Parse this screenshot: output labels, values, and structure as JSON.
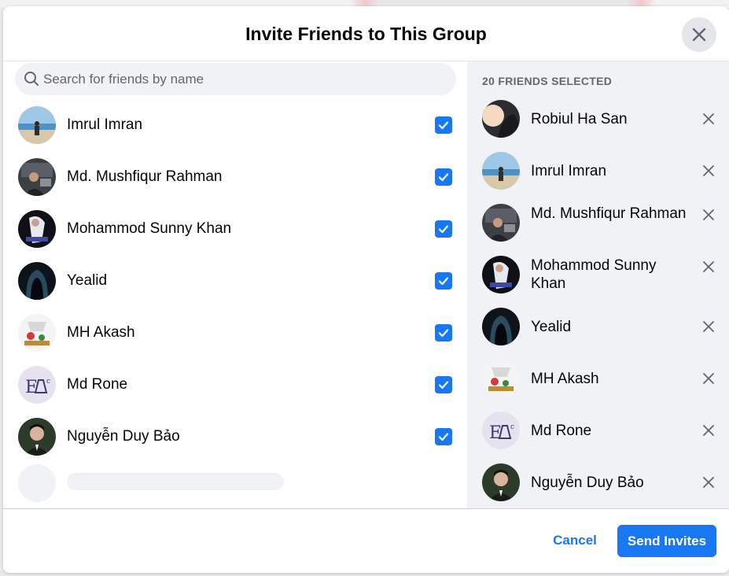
{
  "dialog": {
    "title": "Invite Friends to This Group",
    "close_icon": "close-icon"
  },
  "search": {
    "placeholder": "Search for friends by name",
    "value": "",
    "icon": "search-icon"
  },
  "friends": [
    {
      "name": "Imrul Imran",
      "checked": true
    },
    {
      "name": "Md. Mushfiqur Rahman",
      "checked": true
    },
    {
      "name": "Mohammod Sunny Khan",
      "checked": true
    },
    {
      "name": "Yealid",
      "checked": true
    },
    {
      "name": "MH Akash",
      "checked": true
    },
    {
      "name": "Md Rone",
      "checked": true
    },
    {
      "name": "Nguyễn Duy Bảo",
      "checked": true
    }
  ],
  "selected": {
    "count_label": "20 FRIENDS SELECTED",
    "items": [
      {
        "name": "Robiul Ha San"
      },
      {
        "name": "Imrul Imran"
      },
      {
        "name": "Md. Mushfiqur Rahman"
      },
      {
        "name": "Mohammod Sunny Khan"
      },
      {
        "name": "Yealid"
      },
      {
        "name": "MH Akash"
      },
      {
        "name": "Md Rone"
      },
      {
        "name": "Nguyễn Duy Bảo"
      }
    ]
  },
  "footer": {
    "cancel_label": "Cancel",
    "send_label": "Send Invites"
  },
  "colors": {
    "accent": "#1877f2",
    "panel_bg": "#f0f2f5",
    "text_primary": "#050505",
    "text_secondary": "#65676b"
  }
}
